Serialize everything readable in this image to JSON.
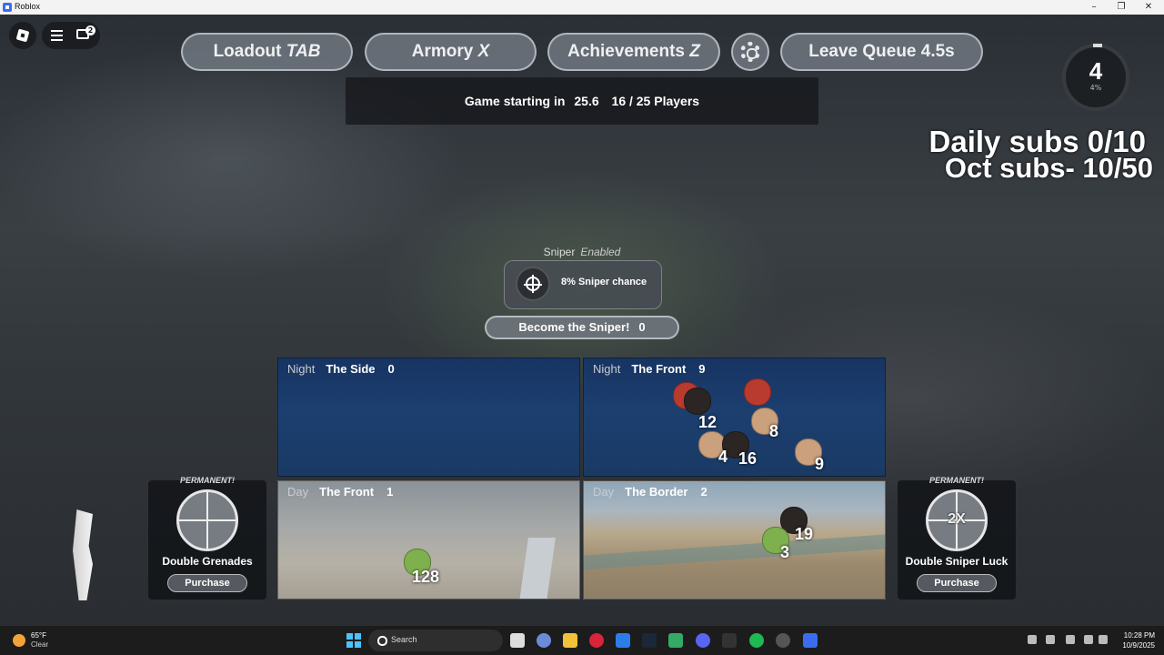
{
  "window": {
    "title": "Roblox",
    "minimize": "–",
    "restore": "❐",
    "close": "✕"
  },
  "roblox_menu": {
    "chat_badge": "2"
  },
  "top_buttons": {
    "loadout": {
      "label": "Loadout",
      "key": "TAB"
    },
    "armory": {
      "label": "Armory",
      "key": "X"
    },
    "achievements": {
      "label": "Achievements",
      "key": "Z"
    },
    "leave": {
      "label": "Leave Queue 4.5s"
    }
  },
  "status": {
    "starting_label": "Game starting in",
    "countdown": "25.6",
    "players": "16 / 25 Players"
  },
  "level": {
    "value": "4",
    "percent": "4%"
  },
  "overlay": {
    "daily": "Daily subs 0/10",
    "monthly": "Oct subs- 10/50"
  },
  "sniper": {
    "label": "Sniper",
    "state": "Enabled",
    "chance": "8% Sniper chance",
    "become": "Become the Sniper!",
    "become_count": "0"
  },
  "maps": [
    {
      "time": "Night",
      "name": "The Side",
      "count": "0",
      "avatars": []
    },
    {
      "time": "Night",
      "name": "The Front",
      "count": "9",
      "avatars": [
        "12",
        "8",
        "4",
        "16",
        "9"
      ]
    },
    {
      "time": "Day",
      "name": "The Front",
      "count": "1",
      "avatars": [
        "128"
      ]
    },
    {
      "time": "Day",
      "name": "The Border",
      "count": "2",
      "avatars": [
        "19",
        "3"
      ]
    }
  ],
  "cards": [
    {
      "tag": "PERMANENT!",
      "name": "Double Grenades",
      "button": "Purchase",
      "icon_text": ""
    },
    {
      "tag": "PERMANENT!",
      "name": "Double Sniper Luck",
      "button": "Purchase",
      "icon_text": "2X"
    }
  ],
  "taskbar": {
    "weather_temp": "65°F",
    "weather_cond": "Clear",
    "search_placeholder": "Search",
    "time": "10:28 PM",
    "date": "10/9/2025"
  },
  "colors": {
    "accent_blue": "#4cc2ff",
    "panel_night": "#1c3f70"
  }
}
